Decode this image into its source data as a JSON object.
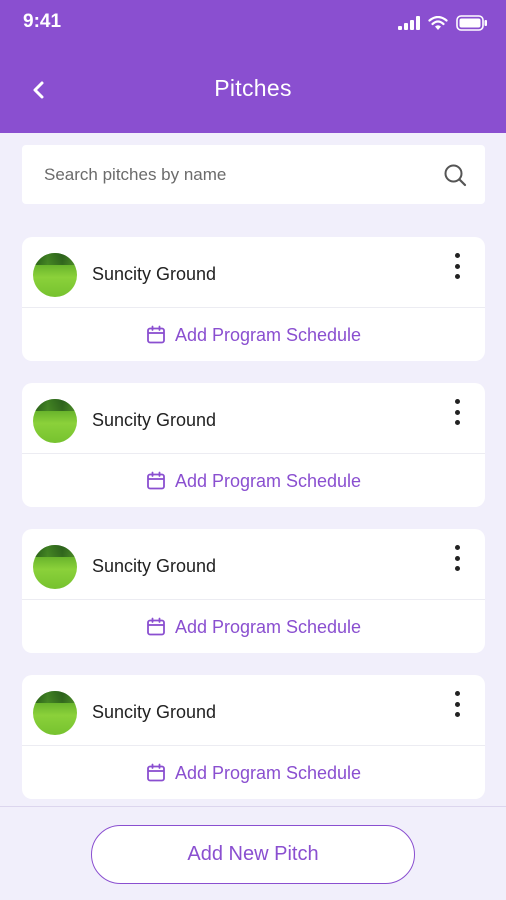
{
  "status_bar": {
    "time": "9:41"
  },
  "nav": {
    "title": "Pitches"
  },
  "search": {
    "placeholder": "Search pitches by name"
  },
  "pitches": [
    {
      "name": "Suncity Ground",
      "action_label": "Add Program Schedule"
    },
    {
      "name": "Suncity Ground",
      "action_label": "Add Program Schedule"
    },
    {
      "name": "Suncity Ground",
      "action_label": "Add Program Schedule"
    },
    {
      "name": "Suncity Ground",
      "action_label": "Add Program Schedule"
    }
  ],
  "footer": {
    "add_button_label": "Add New Pitch"
  },
  "colors": {
    "accent": "#8a4fd0",
    "background": "#f1effb",
    "card": "#ffffff"
  },
  "icons": [
    "back-chevron-icon",
    "search-icon",
    "calendar-icon",
    "more-vertical-icon",
    "signal-icon",
    "wifi-icon",
    "battery-icon"
  ]
}
